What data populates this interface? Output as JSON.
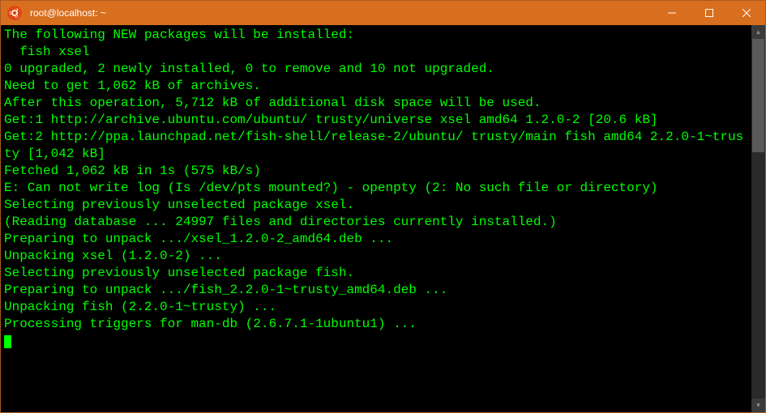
{
  "titlebar": {
    "title": "root@localhost: ~"
  },
  "terminal": {
    "lines": [
      "The following NEW packages will be installed:",
      "  fish xsel",
      "0 upgraded, 2 newly installed, 0 to remove and 10 not upgraded.",
      "Need to get 1,062 kB of archives.",
      "After this operation, 5,712 kB of additional disk space will be used.",
      "Get:1 http://archive.ubuntu.com/ubuntu/ trusty/universe xsel amd64 1.2.0-2 [20.6 kB]",
      "Get:2 http://ppa.launchpad.net/fish-shell/release-2/ubuntu/ trusty/main fish amd64 2.2.0-1~trusty [1,042 kB]",
      "Fetched 1,062 kB in 1s (575 kB/s)",
      "E: Can not write log (Is /dev/pts mounted?) - openpty (2: No such file or directory)",
      "Selecting previously unselected package xsel.",
      "(Reading database ... 24997 files and directories currently installed.)",
      "Preparing to unpack .../xsel_1.2.0-2_amd64.deb ...",
      "Unpacking xsel (1.2.0-2) ...",
      "Selecting previously unselected package fish.",
      "Preparing to unpack .../fish_2.2.0-1~trusty_amd64.deb ...",
      "Unpacking fish (2.2.0-1~trusty) ...",
      "Processing triggers for man-db (2.6.7.1-1ubuntu1) ..."
    ]
  }
}
